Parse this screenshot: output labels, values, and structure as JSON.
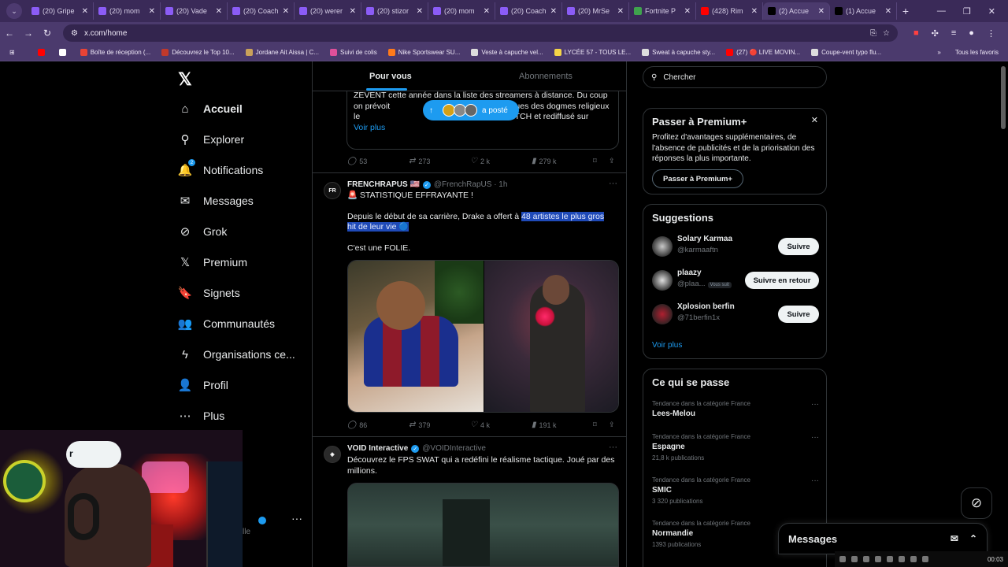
{
  "browser": {
    "tabs": [
      {
        "label": "(20) Gripe",
        "color": "#8b5cf6"
      },
      {
        "label": "(20) mom",
        "color": "#8b5cf6"
      },
      {
        "label": "(20) Vade",
        "color": "#8b5cf6"
      },
      {
        "label": "(20) Coach",
        "color": "#8b5cf6"
      },
      {
        "label": "(20) werer",
        "color": "#8b5cf6"
      },
      {
        "label": "(20) stizor",
        "color": "#8b5cf6"
      },
      {
        "label": "(20) mom",
        "color": "#8b5cf6"
      },
      {
        "label": "(20) Coach",
        "color": "#8b5cf6"
      },
      {
        "label": "(20) MrSe",
        "color": "#8b5cf6"
      },
      {
        "label": "Fortnite P",
        "color": "#3fa34d"
      },
      {
        "label": "(428) Rim",
        "color": "#ff0000"
      },
      {
        "label": "(2) Accue",
        "color": "#000000",
        "active": true
      },
      {
        "label": "(1) Accue",
        "color": "#000000"
      }
    ],
    "url": "x.com/home",
    "bookmarks": [
      {
        "label": "",
        "color": "#ff0000"
      },
      {
        "label": "",
        "color": "#ffffff"
      },
      {
        "label": "Boîte de réception (...",
        "color": "#ea4335"
      },
      {
        "label": "Découvrez le Top 10...",
        "color": "#c0392b"
      },
      {
        "label": "Jordane Ait Aissa | C...",
        "color": "#c9a15a"
      },
      {
        "label": "Suivi de colis",
        "color": "#e0509a"
      },
      {
        "label": "Nike Sportswear SU...",
        "color": "#ff7a1a"
      },
      {
        "label": "Veste à capuche vel...",
        "color": "#dddddd"
      },
      {
        "label": "LYCÉE 57 - TOUS LE...",
        "color": "#f5d547"
      },
      {
        "label": "Sweat à capuche sty...",
        "color": "#dddddd"
      },
      {
        "label": "(27) 🔴 LIVE MOVIN...",
        "color": "#ff0000"
      },
      {
        "label": "Coupe-vent typo flu...",
        "color": "#dddddd"
      }
    ],
    "all_bookmarks": "Tous les favoris"
  },
  "nav": {
    "items": [
      {
        "label": "Accueil",
        "icon": "home-icon",
        "glyph": "⌂"
      },
      {
        "label": "Explorer",
        "icon": "search-icon",
        "glyph": "⚲"
      },
      {
        "label": "Notifications",
        "icon": "bell-icon",
        "glyph": "🔔",
        "badge": "2"
      },
      {
        "label": "Messages",
        "icon": "mail-icon",
        "glyph": "✉"
      },
      {
        "label": "Grok",
        "icon": "grok-icon",
        "glyph": "⊘"
      },
      {
        "label": "Premium",
        "icon": "x-logo-icon",
        "glyph": "𝕏"
      },
      {
        "label": "Signets",
        "icon": "bookmark-icon",
        "glyph": "🔖"
      },
      {
        "label": "Communautés",
        "icon": "people-icon",
        "glyph": "👥"
      },
      {
        "label": "Organisations ce...",
        "icon": "lightning-icon",
        "glyph": "ϟ"
      },
      {
        "label": "Profil",
        "icon": "person-icon",
        "glyph": "👤"
      },
      {
        "label": "Plus",
        "icon": "more-circle-icon",
        "glyph": "⋯"
      }
    ],
    "post_label": "r",
    "account_suffix": "lle"
  },
  "feed": {
    "tab_for_you": "Pour vous",
    "tab_following": "Abonnements",
    "new_posts_label": "a posté",
    "quote_text": "ZEVENT cette année dans la liste des streamers à distance. Du coup on prévoit                                  eamers critiques des dogmes religieux le                                       ur ma chaine TWITCH et rediffusé sur",
    "quote_more": "Voir plus",
    "tweet1_stats": {
      "replies": "53",
      "reposts": "273",
      "likes": "2 k",
      "views": "279 k"
    },
    "tweet2": {
      "name": "FRENCHRAPUS 🇺🇸",
      "handle": "@FrenchRapUS · 1h",
      "avatar": "FR",
      "line1": "🚨 STATISTIQUE EFFRAYANTE !",
      "line2a": "Depuis le début de sa carrière, Drake a offert à ",
      "line2b": "48 artistes le plus gros hit de leur vie 🔵",
      "line3": "C'est une FOLIE.",
      "stats": {
        "replies": "86",
        "reposts": "379",
        "likes": "4 k",
        "views": "191 k"
      }
    },
    "tweet3": {
      "name": "VOID Interactive",
      "handle": "@VOIDInteractive",
      "text": "Découvrez le FPS SWAT qui a redéfini le réalisme tactique. Joué par des millions."
    }
  },
  "sidebar": {
    "search_placeholder": "Chercher",
    "premium": {
      "title": "Passer à Premium+",
      "text": "Profitez d'avantages supplémentaires, de l'absence de publicités et de la priorisation des réponses la plus importante.",
      "button": "Passer à Premium+"
    },
    "suggestions": {
      "title": "Suggestions",
      "items": [
        {
          "name": "Solary Karmaa",
          "handle": "@karmaaftn",
          "button": "Suivre",
          "follows_you": "",
          "color": "#c8c8c8"
        },
        {
          "name": "plaazy",
          "handle": "@plaa...",
          "button": "Suivre en retour",
          "follows_you": "Vous suit",
          "color": "#e0e0e0"
        },
        {
          "name": "Xplosion berfin",
          "handle": "@71berfin1x",
          "button": "Suivre",
          "follows_you": "",
          "color": "#b02030"
        }
      ],
      "more": "Voir plus"
    },
    "trends": {
      "title": "Ce qui se passe",
      "items": [
        {
          "category": "Tendance dans la catégorie France",
          "name": "Lees-Melou",
          "posts": ""
        },
        {
          "category": "Tendance dans la catégorie France",
          "name": "Espagne",
          "posts": "21,8 k publications"
        },
        {
          "category": "Tendance dans la catégorie France",
          "name": "SMIC",
          "posts": "3 320 publications"
        },
        {
          "category": "Tendance dans la catégorie France",
          "name": "Normandie",
          "posts": "1393 publications"
        }
      ]
    }
  },
  "messages_drawer": "Messages",
  "taskbar_time": "00:03"
}
